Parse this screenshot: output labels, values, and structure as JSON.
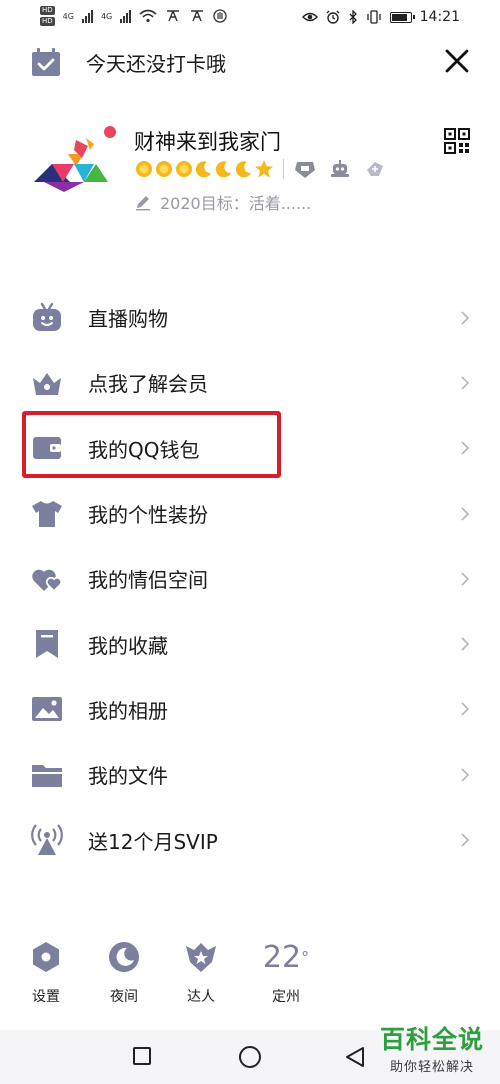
{
  "status_bar": {
    "hd1": "HD",
    "hd2": "HD",
    "net1": "4G",
    "net2": "4G",
    "time": "14:21"
  },
  "header": {
    "checkin_text": "今天还没打卡哦"
  },
  "profile": {
    "name": "财神来到我家门",
    "signature": "2020目标：活着......"
  },
  "menu": {
    "items": [
      {
        "label": "直播购物",
        "icon": "tv-robot-icon"
      },
      {
        "label": "点我了解会员",
        "icon": "crown-icon"
      },
      {
        "label": "我的QQ钱包",
        "icon": "wallet-icon"
      },
      {
        "label": "我的个性装扮",
        "icon": "tshirt-icon"
      },
      {
        "label": "我的情侣空间",
        "icon": "hearts-icon"
      },
      {
        "label": "我的收藏",
        "icon": "bookmark-icon"
      },
      {
        "label": "我的相册",
        "icon": "photo-icon"
      },
      {
        "label": "我的文件",
        "icon": "folder-icon"
      },
      {
        "label": "送12个月SVIP",
        "icon": "broadcast-icon"
      }
    ]
  },
  "bottom_bar": {
    "settings": "设置",
    "night": "夜间",
    "expert": "达人",
    "temperature": "22",
    "temperature_unit": "°",
    "city": "定州"
  },
  "watermark": {
    "title": "百科全说",
    "subtitle": "助你轻松解决"
  },
  "colors": {
    "icon_gray": "#7d7f9e",
    "highlight_red": "#d81e2a",
    "watermark_green": "#2e9e3e"
  }
}
